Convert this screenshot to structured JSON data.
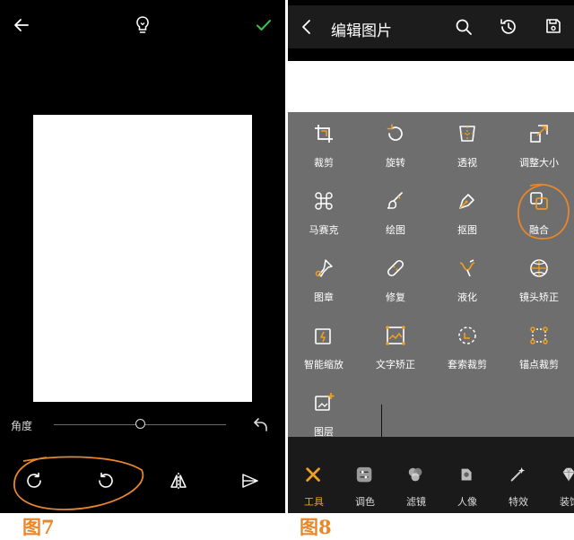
{
  "left_editor": {
    "angle_label": "角度",
    "slider_value_fraction": 0.5,
    "figure_label": "图7"
  },
  "right_editor": {
    "title": "编辑图片",
    "tools": [
      {
        "label": "裁剪",
        "icon": "crop-icon"
      },
      {
        "label": "旋转",
        "icon": "rotate-icon"
      },
      {
        "label": "透视",
        "icon": "perspective-icon"
      },
      {
        "label": "调整大小",
        "icon": "resize-icon"
      },
      {
        "label": "马赛克",
        "icon": "mosaic-icon"
      },
      {
        "label": "绘图",
        "icon": "brush-icon"
      },
      {
        "label": "抠图",
        "icon": "cutout-pen-icon"
      },
      {
        "label": "融合",
        "icon": "blend-icon"
      },
      {
        "label": "图章",
        "icon": "stamp-icon"
      },
      {
        "label": "修复",
        "icon": "bandage-icon"
      },
      {
        "label": "液化",
        "icon": "liquify-icon"
      },
      {
        "label": "镜头矫正",
        "icon": "lens-correct-icon"
      },
      {
        "label": "智能缩放",
        "icon": "smart-scale-icon"
      },
      {
        "label": "文字矫正",
        "icon": "text-correct-icon"
      },
      {
        "label": "套索裁剪",
        "icon": "lasso-crop-icon"
      },
      {
        "label": "锚点裁剪",
        "icon": "anchor-crop-icon"
      },
      {
        "label": "图层",
        "icon": "layer-add-icon"
      }
    ],
    "bottom_tabs": [
      {
        "label": "工具",
        "icon": "tools-icon",
        "active": true
      },
      {
        "label": "调色",
        "icon": "adjust-icon"
      },
      {
        "label": "滤镜",
        "icon": "filter-icon"
      },
      {
        "label": "人像",
        "icon": "portrait-icon"
      },
      {
        "label": "特效",
        "icon": "effects-icon"
      },
      {
        "label": "装饰",
        "icon": "decor-icon"
      }
    ],
    "figure_label": "图8"
  },
  "colors": {
    "accent": "#f0a020",
    "confirm": "#3ac24a",
    "annotation": "#e8862a"
  }
}
